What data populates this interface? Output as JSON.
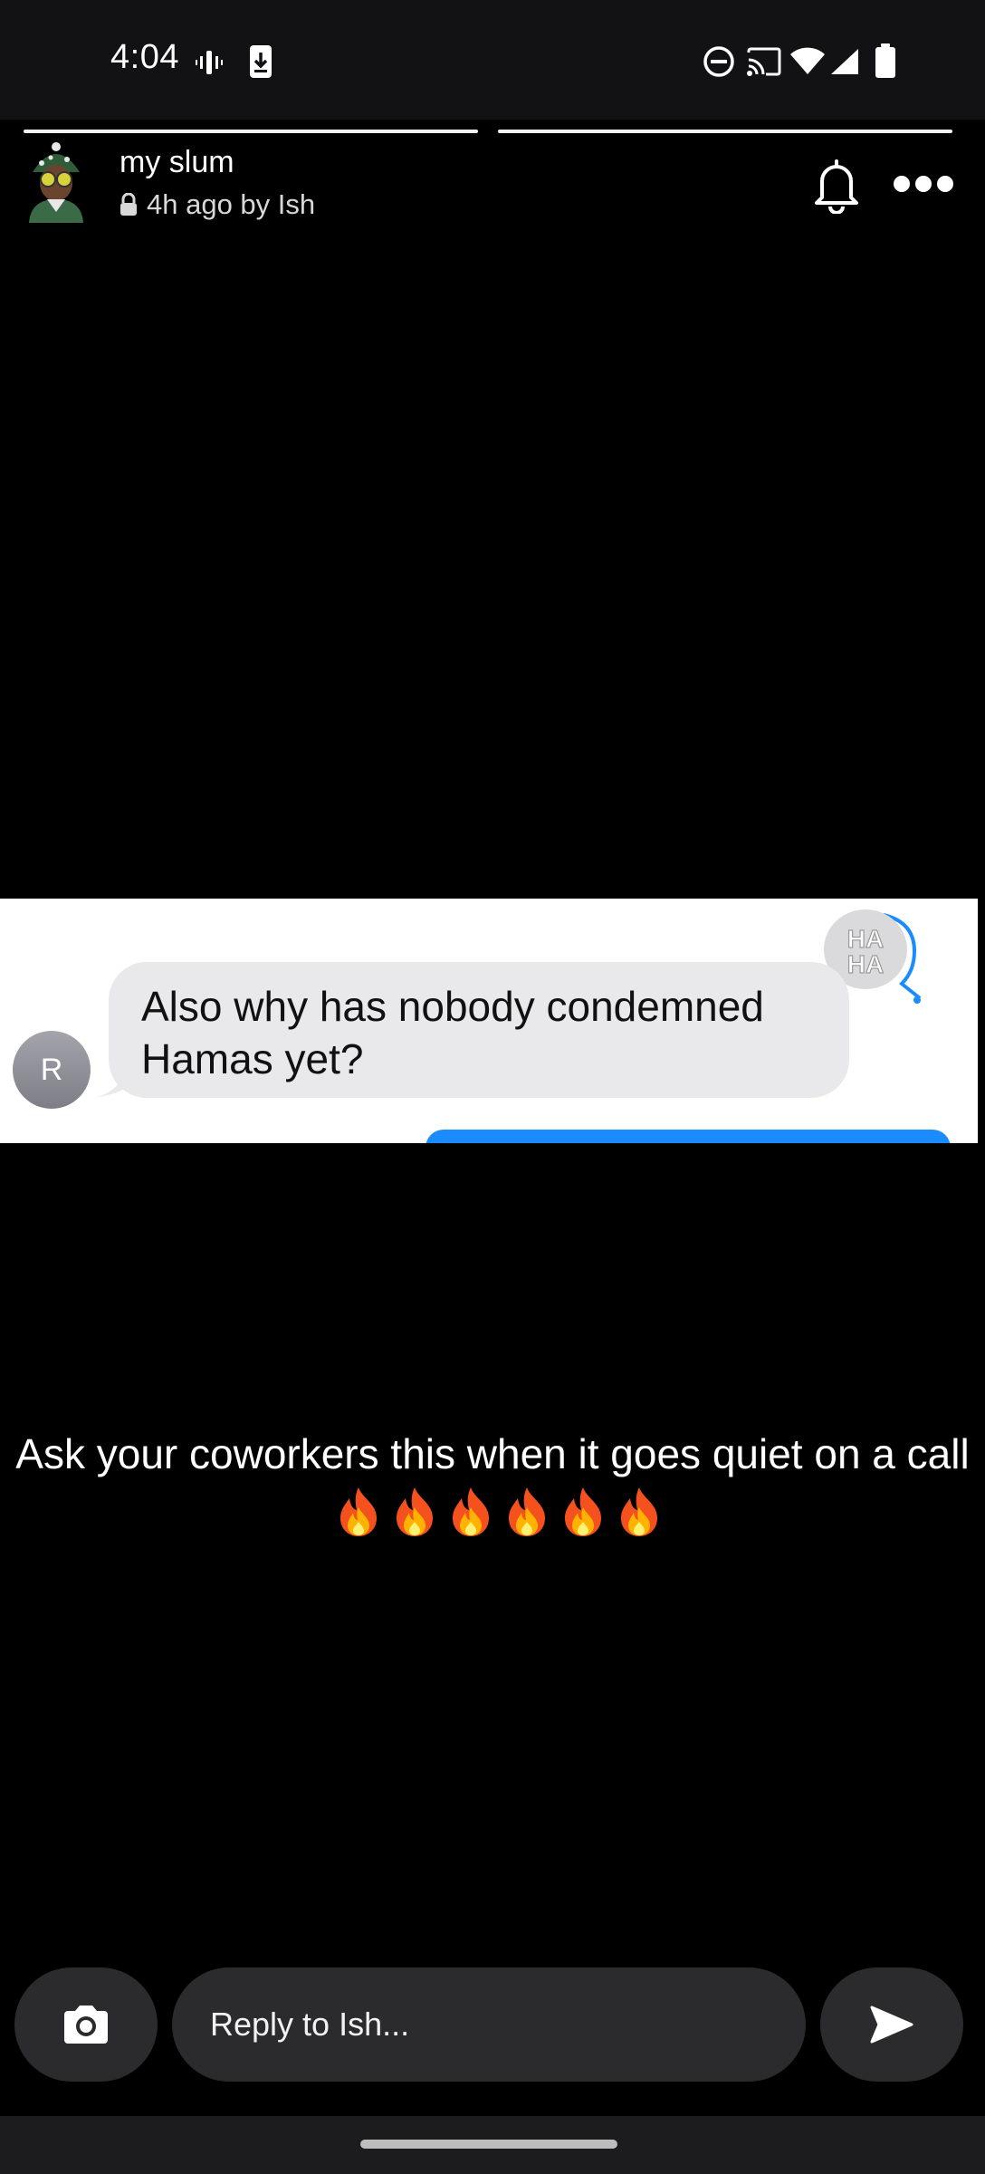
{
  "status_bar": {
    "time": "4:04",
    "left_icons": [
      "vibrate-icon",
      "download-icon"
    ],
    "right_icons": [
      "dnd-icon",
      "cast-icon",
      "wifi-icon",
      "signal-icon",
      "battery-icon"
    ]
  },
  "story": {
    "title": "my slum",
    "meta": "4h ago by Ish",
    "progress_segments": 2
  },
  "screenshot": {
    "message": "Also why has nobody condemned Hamas yet?",
    "avatar_initial": "R",
    "reaction": "HA HA"
  },
  "caption": {
    "text": "Ask your coworkers this when it goes quiet on a call",
    "emoji": "🔥",
    "emoji_count": 6
  },
  "reply": {
    "placeholder": "Reply to Ish..."
  },
  "colors": {
    "background": "#000000",
    "status_bar": "#121214",
    "input_bg": "#2b2b2d",
    "bubble_gray": "#e9e9eb",
    "imessage_blue": "#1a8cff"
  }
}
